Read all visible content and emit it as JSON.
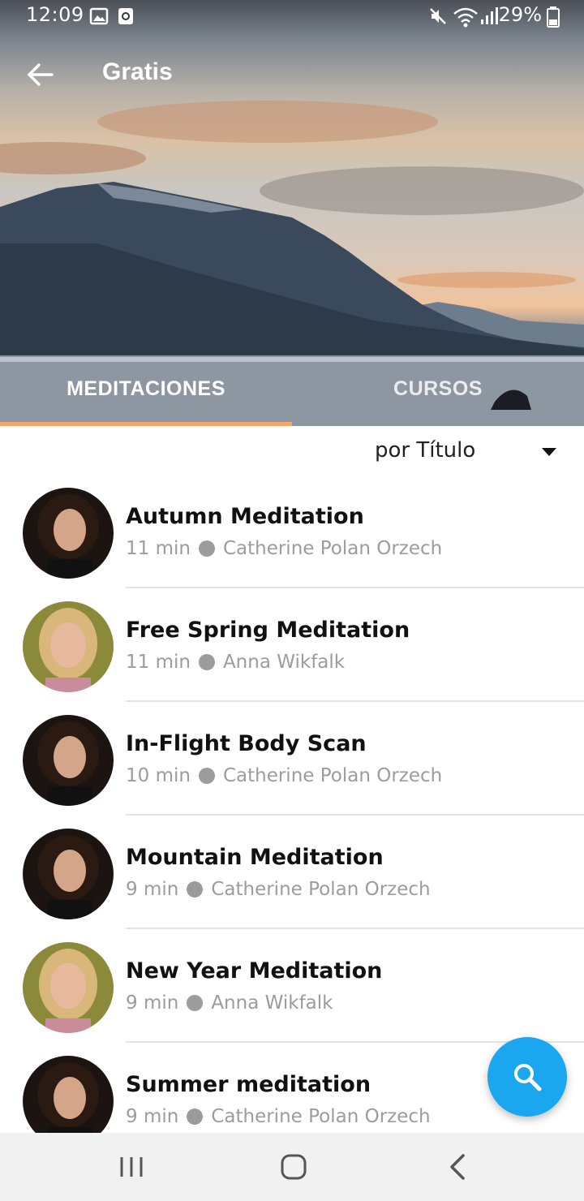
{
  "status_bar": {
    "time": "12:09",
    "battery": "29%",
    "icons": [
      "gallery-icon",
      "screenshot-icon",
      "mute-icon",
      "wifi-icon",
      "signal-icon",
      "battery-icon"
    ]
  },
  "toolbar": {
    "title": "Gratis"
  },
  "tabs": [
    {
      "label": "MEDITACIONES",
      "selected": true
    },
    {
      "label": "CURSOS",
      "selected": false
    }
  ],
  "sort": {
    "label": "por Título"
  },
  "items": [
    {
      "title": "Autumn Meditation",
      "duration": "11 min",
      "author": "Catherine Polan Orzech"
    },
    {
      "title": "Free Spring Meditation",
      "duration": "11 min",
      "author": "Anna Wikfalk"
    },
    {
      "title": "In-Flight Body Scan",
      "duration": "10 min",
      "author": "Catherine Polan Orzech"
    },
    {
      "title": "Mountain Meditation",
      "duration": "9 min",
      "author": "Catherine Polan Orzech"
    },
    {
      "title": "New Year Meditation",
      "duration": "9 min",
      "author": "Anna Wikfalk"
    },
    {
      "title": "Summer meditation",
      "duration": "9 min",
      "author": "Catherine Polan Orzech"
    }
  ],
  "colors": {
    "accent": "#f2a76c",
    "fab": "#1aa7f0",
    "meta": "#9c9c9c"
  }
}
